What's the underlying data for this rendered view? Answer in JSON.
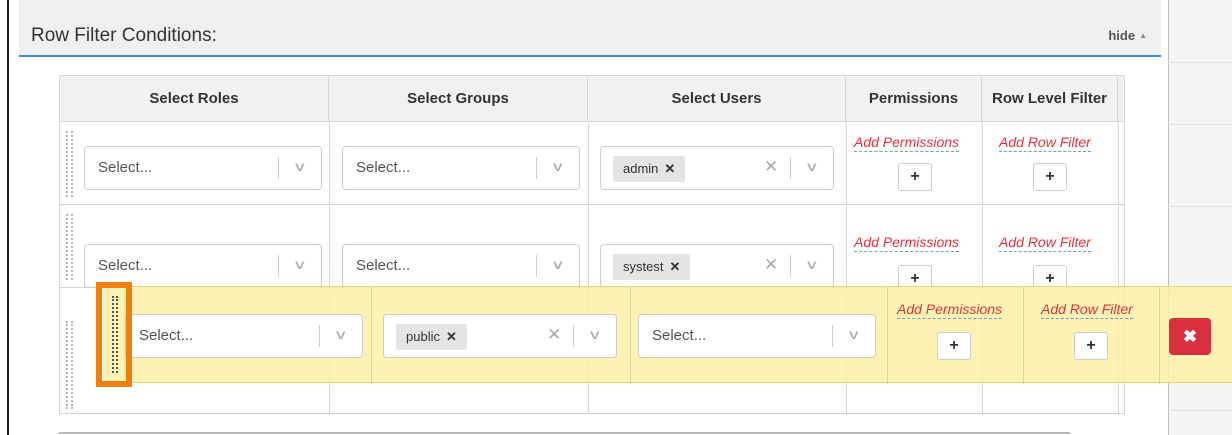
{
  "panel": {
    "title": "Row Filter Conditions:",
    "hide_label": "hide"
  },
  "table": {
    "headers": [
      "Select Roles",
      "Select Groups",
      "Select Users",
      "Permissions",
      "Row Level Filter"
    ],
    "placeholder": "Select...",
    "add_permissions_label": "Add Permissions",
    "add_row_filter_label": "Add Row Filter",
    "plus_label": "+",
    "rows": [
      {
        "roles": "",
        "groups": "",
        "users": "admin"
      },
      {
        "roles": "",
        "groups": "",
        "users": "systest"
      },
      {
        "roles": "",
        "groups": "public",
        "users": ""
      }
    ]
  },
  "drag_row": {
    "roles": "",
    "groups": "public",
    "users": ""
  },
  "icons": {
    "delete": "close-icon",
    "grip": "drag-handle-icon",
    "chevron": "chevron-down-icon",
    "clear": "clear-icon"
  },
  "colors": {
    "accent_red": "#e8313a",
    "drag_highlight": "#f07f12",
    "drag_bg": "#fbf0a8",
    "delete_bg": "#d9303d",
    "panel_underline": "#3d90c7"
  }
}
